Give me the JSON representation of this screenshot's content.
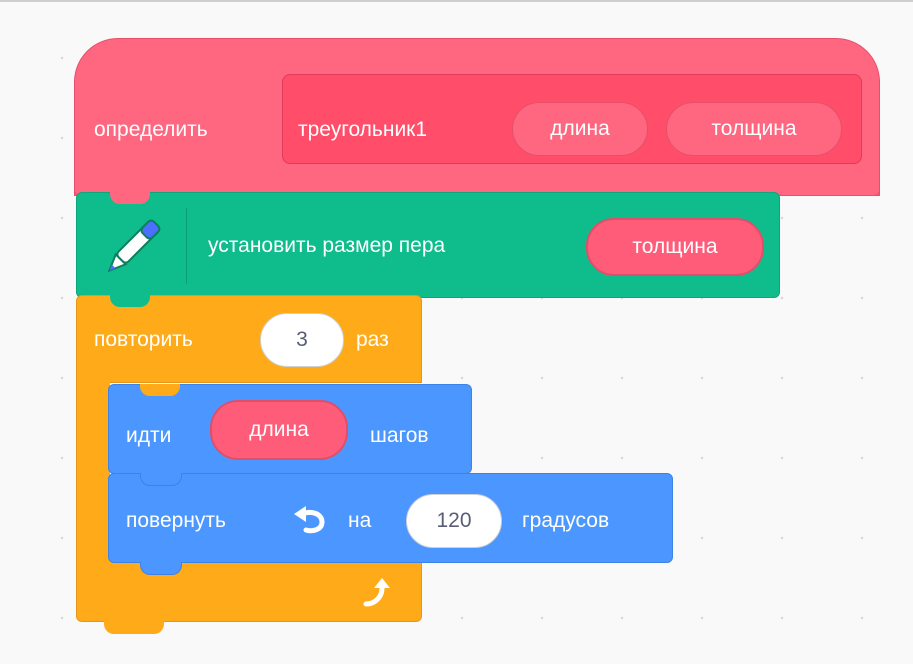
{
  "define_block": {
    "keyword": "определить",
    "name": "треугольник1",
    "params": [
      "длина",
      "толщина"
    ]
  },
  "pen_block": {
    "icon": "pen-icon",
    "label": "установить размер пера",
    "arg": "толщина"
  },
  "repeat_block": {
    "label_before": "повторить",
    "count": "3",
    "label_after": "раз",
    "icon": "loop-arrow-icon"
  },
  "move_block": {
    "label_before": "идти",
    "arg": "длина",
    "label_after": "шагов"
  },
  "turn_block": {
    "label_before": "повернуть",
    "icon": "rotate-left-icon",
    "label_mid": "на",
    "degrees": "120",
    "label_after": "градусов"
  },
  "colors": {
    "myblocks": "#ff6680",
    "pen": "#0fbd8c",
    "control": "#ffab19",
    "motion": "#4c97ff",
    "background": "#f9f9f9"
  }
}
